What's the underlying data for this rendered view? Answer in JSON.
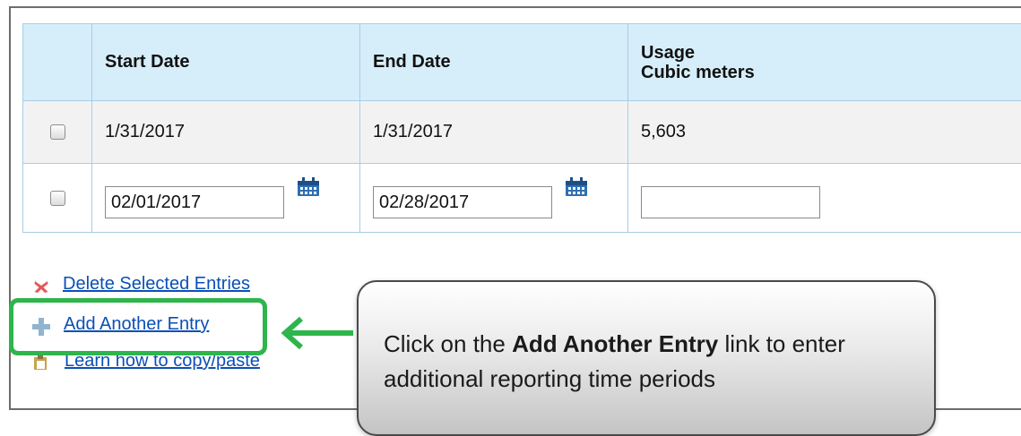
{
  "table": {
    "headers": {
      "start_date": "Start Date",
      "end_date": "End Date",
      "usage_line1": "Usage",
      "usage_line2": "Cubic meters"
    },
    "rows": [
      {
        "start": "1/31/2017",
        "end": "1/31/2017",
        "usage": "5,603"
      }
    ],
    "edit_row": {
      "start": "02/01/2017",
      "end": "02/28/2017",
      "usage": ""
    }
  },
  "links": {
    "delete": "Delete Selected Entries",
    "add": "Add Another Entry",
    "learn": "Learn how to copy/paste"
  },
  "callout": {
    "prefix": "Click on the ",
    "bold": "Add Another Entry",
    "suffix": " link to enter additional reporting time periods"
  },
  "colors": {
    "header_bg": "#d6eefa",
    "border": "#a9cde4",
    "link": "#0b4fb6",
    "highlight": "#2eb54b",
    "delete_icon": "#e05a5a"
  },
  "icons": {
    "calendar": "calendar-icon",
    "delete": "delete-x-icon",
    "add": "plus-icon",
    "learn": "clipboard-icon"
  }
}
